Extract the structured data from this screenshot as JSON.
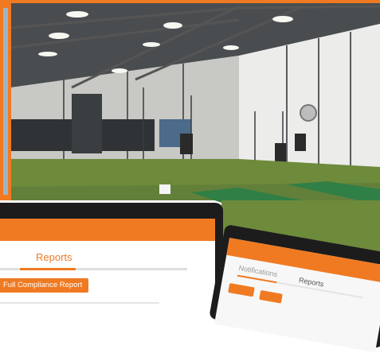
{
  "left_screen": {
    "tab_label": "Reports",
    "button_label": "Full Compliance Report"
  },
  "right_screen": {
    "label_left": "Notifications",
    "label_right": "Reports"
  },
  "colors": {
    "accent": "#f07a22",
    "turf": "#6e8a3b",
    "mound": "#2f7f46",
    "wall": "#e6e6e2",
    "roof": "#4a4d50"
  }
}
